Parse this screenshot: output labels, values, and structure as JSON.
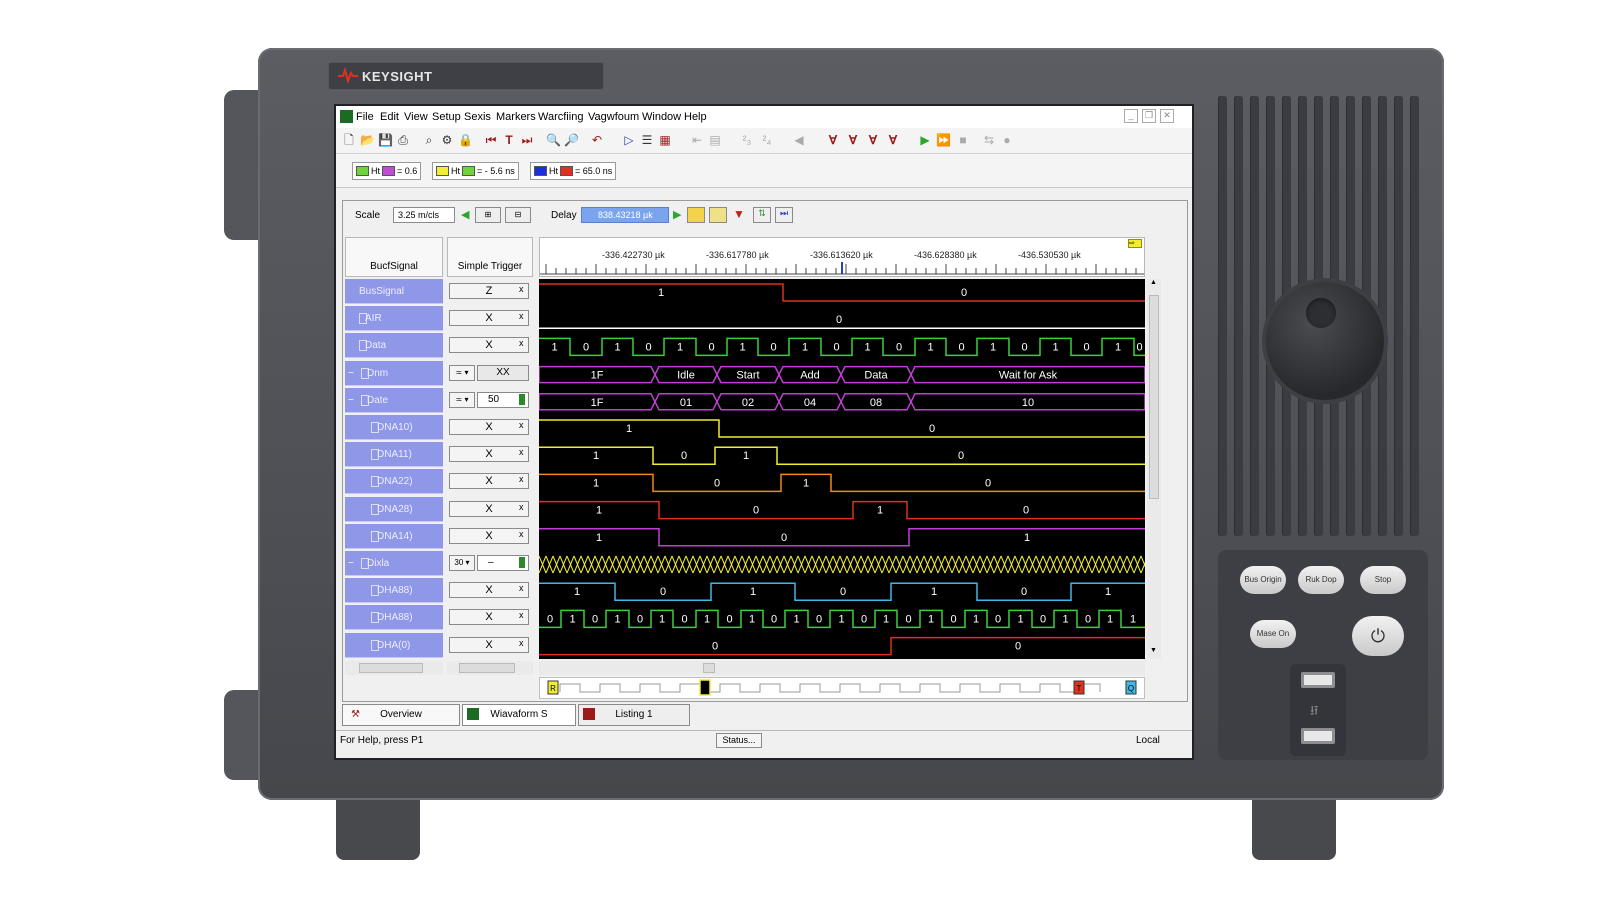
{
  "device": {
    "brand": "KEYSIGHT",
    "buttons": [
      {
        "label": "Bus Origin"
      },
      {
        "label": "Ruk Dop"
      },
      {
        "label": "Stop"
      },
      {
        "label": "Mase On"
      }
    ]
  },
  "app": {
    "menus": [
      "File",
      "Edit",
      "View",
      "Setup",
      "Sexis",
      "Markers",
      "Warcfiing",
      "Vagwfoum",
      "Window",
      "Help"
    ],
    "markers": [
      {
        "a_color": "#6fd33a",
        "b_color": "#c04bd6",
        "label": "Ht",
        "value": "= 0.6"
      },
      {
        "a_color": "#f0ee2e",
        "b_color": "#6fd33a",
        "label": "Ht",
        "value": "= - 5.6 ns"
      },
      {
        "a_color": "#1a2fe0",
        "b_color": "#e0301e",
        "label": "Ht",
        "value": "= 65.0 ns"
      }
    ],
    "scale_label": "Scale",
    "scale_value": "3.25 m/cls",
    "delay_label": "Delay",
    "delay_value": "838.43218 µk",
    "col_signal": "BucfSignal",
    "col_trigger": "Simple Trigger",
    "ruler_ticks": [
      "-336.422730 µk",
      "-336.617780 µk",
      "-336.613620 µk",
      "-436.628380 µk",
      "-436.530530 µk"
    ],
    "signals": [
      {
        "name": "BusSignal",
        "trigger": "Z",
        "kind": "x"
      },
      {
        "name": "AIR",
        "trigger": "X",
        "kind": "x"
      },
      {
        "name": "Data",
        "trigger": "X",
        "kind": "x"
      },
      {
        "name": "Dnm",
        "trigger": "XX",
        "kind": "combo",
        "expand": "−",
        "combo": "≍"
      },
      {
        "name": "Date",
        "trigger": "50",
        "kind": "num",
        "expand": "−",
        "combo": "≍"
      },
      {
        "name": "DNA10)",
        "trigger": "X",
        "kind": "x"
      },
      {
        "name": "DNA11)",
        "trigger": "X",
        "kind": "x"
      },
      {
        "name": "DNA22)",
        "trigger": "X",
        "kind": "x"
      },
      {
        "name": "DNA28)",
        "trigger": "X",
        "kind": "x"
      },
      {
        "name": "DNA14)",
        "trigger": "X",
        "kind": "x"
      },
      {
        "name": "Dixla",
        "trigger": "–",
        "kind": "num",
        "expand": "−",
        "combo": "30"
      },
      {
        "name": "DHA88)",
        "trigger": "X",
        "kind": "x"
      },
      {
        "name": "DHA88)",
        "trigger": "X",
        "kind": "x"
      },
      {
        "name": "DHA(0)",
        "trigger": "X",
        "kind": "x"
      }
    ],
    "waves": {
      "r0": {
        "color": "#e0301e",
        "labels": [
          "1",
          "0"
        ]
      },
      "r1": {
        "color": "#ffffff",
        "labels": [
          "0"
        ]
      },
      "r2": {
        "color": "#39d13a",
        "labels": [
          "1",
          "0",
          "1",
          "0",
          "1",
          "0",
          "1",
          "0",
          "1",
          "0",
          "1",
          "0",
          "1",
          "0",
          "1",
          "0",
          "1",
          "0",
          "1",
          "0"
        ]
      },
      "r3": {
        "color": "#c23fd6",
        "labels": [
          "1F",
          "Idle",
          "Start",
          "Add",
          "Data",
          "Wait for Ask"
        ]
      },
      "r4": {
        "color": "#c23fd6",
        "labels": [
          "1F",
          "01",
          "02",
          "04",
          "08",
          "10"
        ]
      },
      "r5": {
        "color": "#f0ee2e",
        "labels": [
          "1",
          "0"
        ]
      },
      "r6": {
        "color": "#f0ee2e",
        "labels": [
          "1",
          "0",
          "1",
          "0"
        ]
      },
      "r7": {
        "color": "#f08a1e",
        "labels": [
          "1",
          "0",
          "1",
          "0"
        ]
      },
      "r8": {
        "color": "#e0301e",
        "labels": [
          "1",
          "0",
          "1",
          "0"
        ]
      },
      "r9": {
        "color": "#c23fd6",
        "labels": [
          "1",
          "0",
          "1"
        ]
      },
      "r10": {
        "color": "#f0ee2e",
        "labels": []
      },
      "r11": {
        "color": "#3fb8e6",
        "labels": [
          "1",
          "0",
          "1",
          "0",
          "1",
          "0",
          "1"
        ]
      },
      "r12": {
        "color": "#39d13a",
        "labels": [
          "0",
          "1",
          "0",
          "1",
          "0",
          "1",
          "0",
          "1",
          "0",
          "1",
          "0",
          "1",
          "0",
          "1",
          "0",
          "1",
          "0",
          "1",
          "0",
          "1",
          "0",
          "1",
          "0",
          "1",
          "0",
          "1",
          "1"
        ]
      },
      "r13": {
        "color": "#e0301e",
        "labels": [
          "0",
          "0"
        ]
      }
    },
    "tabs": [
      "Overview",
      "Wiavaform S",
      "Listing 1"
    ],
    "status_help": "For Help, press P1",
    "status_button": "Status...",
    "status_mode": "Local",
    "strip_markers": [
      "R",
      "T",
      "Q"
    ]
  }
}
